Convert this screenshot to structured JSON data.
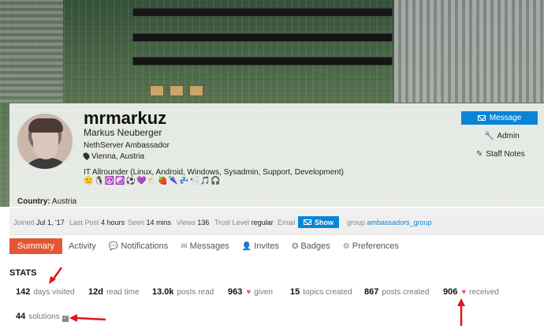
{
  "profile": {
    "username": "mrmarkuz",
    "full_name": "Markus Neuberger",
    "title": "NethServer Ambassador",
    "location": "Vienna, Austria",
    "bio": "IT Allrounder (Linux, Android, Windows, Sysadmin, Support, Development)",
    "emojis": "🙂🐧☮️☯️⚽💜⛅🍓🌂💤🛀🎵🎧",
    "country_label": "Country:",
    "country_value": "Austria"
  },
  "actions": {
    "message": "Message",
    "admin": "Admin",
    "staff_notes": "Staff Notes"
  },
  "meta": {
    "joined_label": "Joined",
    "joined_value": "Jul 1, '17",
    "last_post_label": "Last Post",
    "last_post_value": "4 hours",
    "seen_label": "Seen",
    "seen_value": "14 mins",
    "views_label": "Views",
    "views_value": "136",
    "trust_label": "Trust Level",
    "trust_value": "regular",
    "email_label": "Email",
    "show_button": "Show",
    "group_label": "group",
    "group_value": "ambassadors_group"
  },
  "tabs": [
    {
      "label": "Summary"
    },
    {
      "label": "Activity"
    },
    {
      "label": "Notifications"
    },
    {
      "label": "Messages"
    },
    {
      "label": "Invites"
    },
    {
      "label": "Badges"
    },
    {
      "label": "Preferences"
    }
  ],
  "stats": {
    "heading": "STATS",
    "days_visited": {
      "value": "142",
      "label": "days visited"
    },
    "read_time": {
      "value": "12d",
      "label": "read time"
    },
    "posts_read": {
      "value": "13.0k",
      "label": "posts read"
    },
    "given": {
      "value": "963",
      "label": "given"
    },
    "topics_created": {
      "value": "15",
      "label": "topics created"
    },
    "posts_created": {
      "value": "867",
      "label": "posts created"
    },
    "received": {
      "value": "906",
      "label": "received"
    },
    "solutions": {
      "value": "44",
      "label": "solutions"
    }
  },
  "colors": {
    "accent_blue": "#0a85d6",
    "active_tab": "#e45735",
    "heart": "#e45a84",
    "annotation_red": "#e0141e"
  }
}
